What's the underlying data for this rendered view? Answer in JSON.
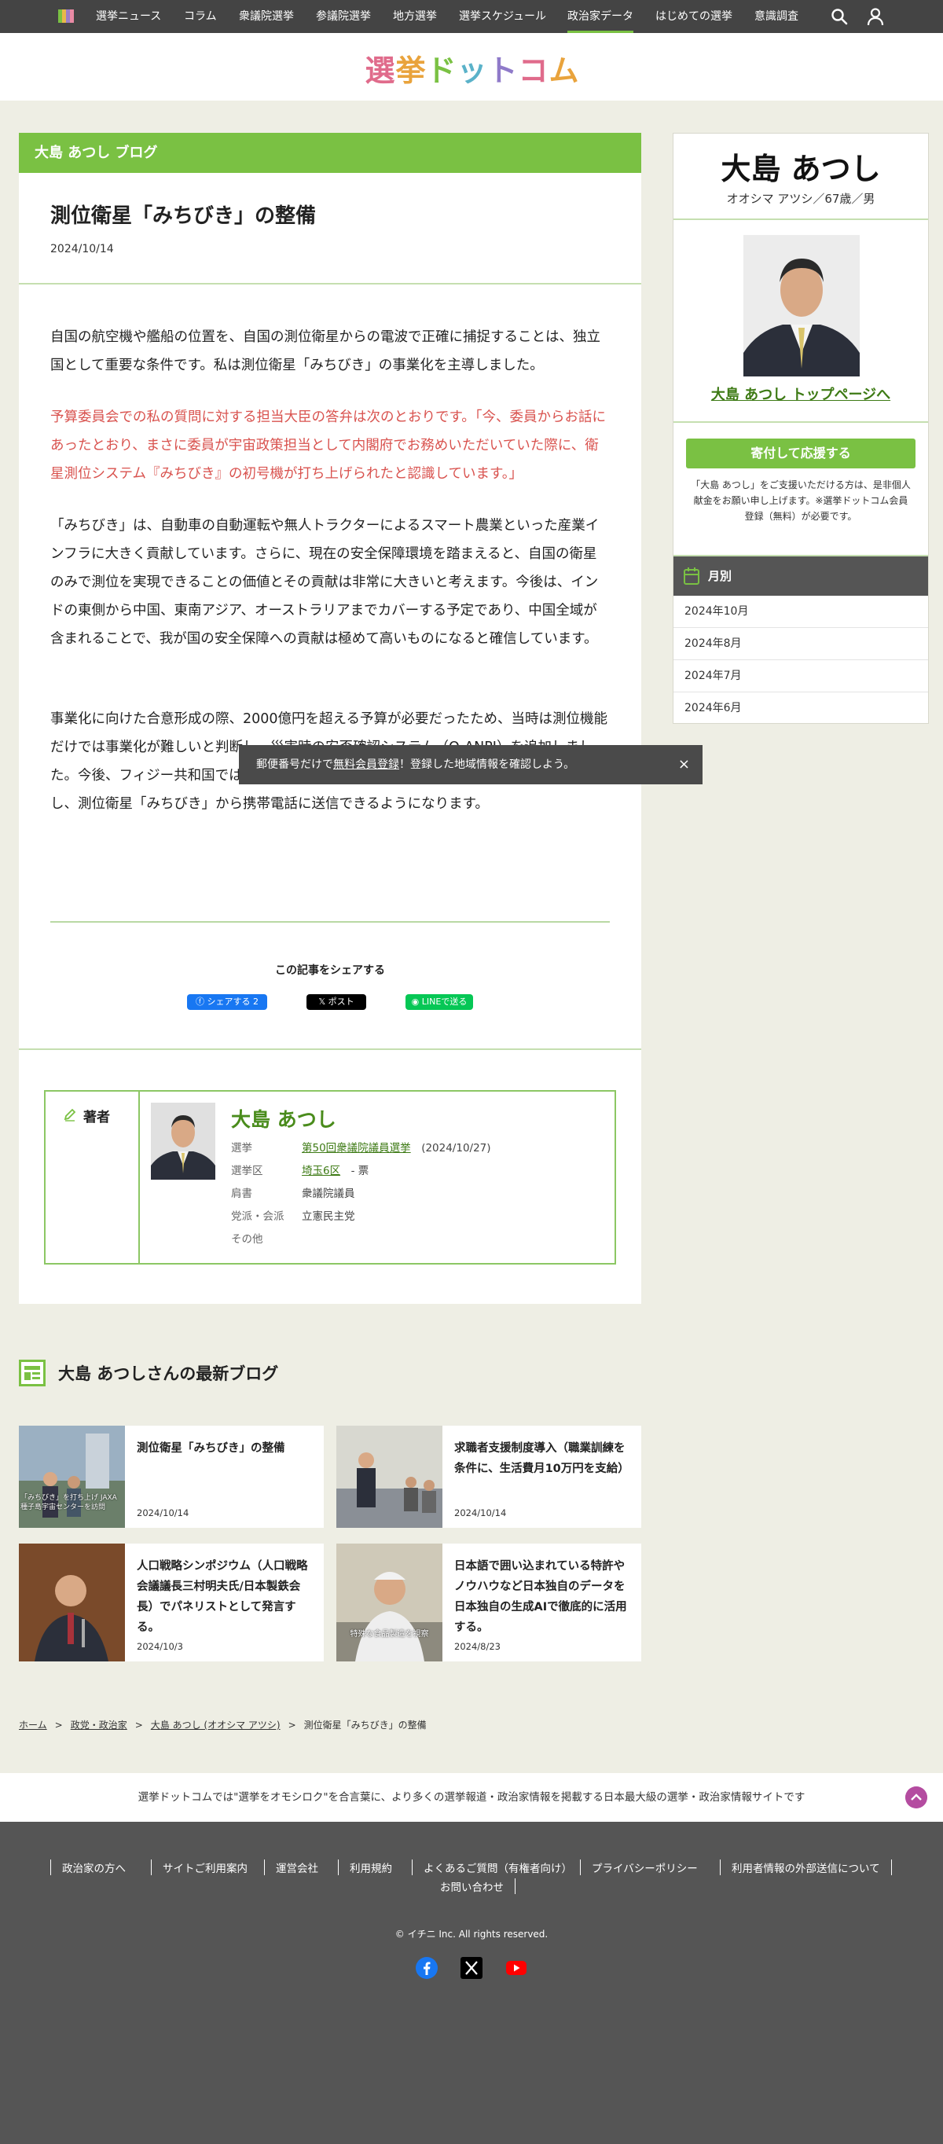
{
  "topnav": {
    "items": [
      "選挙ニュース",
      "コラム",
      "衆議院選挙",
      "参議院選挙",
      "地方選挙",
      "選挙スケジュール",
      "政治家データ",
      "はじめての選挙",
      "意識調査"
    ],
    "active_index": 6,
    "icons": [
      "search-icon",
      "user-icon"
    ]
  },
  "brand": {
    "logo_text": "選挙ドットコム"
  },
  "article": {
    "blog_header": "大島 あつし ブログ",
    "title": "測位衛星「みちびき」の整備",
    "date": "2024/10/14",
    "paragraphs": [
      "自国の航空機や艦船の位置を、自国の測位衛星からの電波で正確に捕捉することは、独立国として重要な条件です。私は測位衛星「みちびき」の事業化を主導しました。",
      "予算委員会での私の質問に対する担当大臣の答弁は次のとおりです。「今、委員からお話にあったとおり、まさに委員が宇宙政策担当として内閣府でお務めいただいていた際に、衛星測位システム『みちびき』の初号機が打ち上げられたと認識しています。」",
      "「みちびき」は、自動車の自動運転や無人トラクターによるスマート農業といった産業インフラに大きく貢献しています。さらに、現在の安全保障環境を踏まえると、自国の衛星のみで測位を実現できることの価値とその貢献は非常に大きいと考えます。今後は、インドの東側から中国、東南アジア、オーストラリアまでカバーする予定であり、中国全域が含まれることで、我が国の安全保障への貢献は極めて高いものになると確信しています。",
      "事業化に向けた合意形成の際、2000億円を超える予算が必要だったため、当時は測位機能だけでは事業化が難しいと判断し、災害時の安否確認システム（Q-ANPI）を追加しました。今後、フィジー共和国では、この「みちびき」の災害危機管理通報サービスを活用し、測位衛星「みちびき」から携帯電話に送信できるようになります。"
    ],
    "share_title": "この記事をシェアする",
    "share_buttons": {
      "facebook": "シェアする 2",
      "x": "ポスト",
      "line": "LINEで送る"
    }
  },
  "author": {
    "label": "著者",
    "name": "大島 あつし",
    "rows": [
      {
        "key": "選挙",
        "value": "第50回衆議院議員選挙",
        "extra": "(2024/10/27)"
      },
      {
        "key": "選挙区",
        "value": "埼玉6区",
        "extra": "- 票"
      },
      {
        "key": "肩書",
        "value": "衆議院議員",
        "extra": ""
      },
      {
        "key": "党派・会派",
        "value": "立憲民主党",
        "extra": ""
      },
      {
        "key": "その他",
        "value": "",
        "extra": ""
      }
    ]
  },
  "sidebar": {
    "name": "大島 あつし",
    "kana": "オオシマ アツシ／67歳／男",
    "top_link": "大島 あつし トップページへ",
    "donate_button": "寄付して応援する",
    "donate_note": "「大島 あつし」をご支援いただける方は、是非個人献金をお願い申し上げます。※選挙ドットコム会員登録（無料）が必要です。",
    "monthly_header": "月別",
    "months": [
      "2024年10月",
      "2024年8月",
      "2024年7月",
      "2024年6月"
    ]
  },
  "toast": {
    "before": "郵便番号だけで",
    "link": "無料会員登録",
    "after": "！登録した地域情報を確認しよう。",
    "close": "×"
  },
  "latest": {
    "title": "大島 あつしさんの最新ブログ",
    "cards": [
      {
        "title": "測位衛星「みちびき」の整備",
        "date": "2024/10/14"
      },
      {
        "title": "求職者支援制度導入（職業訓練を条件に、生活費月10万円を支給）",
        "date": "2024/10/14"
      },
      {
        "title": "人口戦略シンポジウム（人口戦略会議議長三村明夫氏/日本製鉄会長）でパネリストとして発言する。",
        "date": "2024/10/3"
      },
      {
        "title": "日本語で囲い込まれている特許やノウハウなど日本独自のデータを日本独自の生成AIで徹底的に活用する。",
        "date": "2024/8/23"
      }
    ],
    "thumb_captions": [
      "「みちびき」を打ち上げ JAXA種子島宇宙センターを訪問",
      "",
      "",
      "特殊な食品製造を視察"
    ]
  },
  "breadcrumbs": [
    "ホーム",
    "政党・政治家",
    "大島 あつし (オオシマ アツシ)",
    "測位衛星「みちびき」の整備"
  ],
  "tagline": "選挙ドットコムでは\"選挙をオモシロク\"を合言葉に、より多くの選挙報道・政治家情報を掲載する日本最大級の選挙・政治家情報サイトです",
  "footer": {
    "links": [
      "政治家の方へ",
      "サイトご利用案内",
      "運営会社",
      "利用規約",
      "よくあるご質問（有権者向け）",
      "プライバシーポリシー",
      "利用者情報の外部送信について",
      "お問い合わせ"
    ],
    "copyright": "© イチニ Inc. All rights reserved.",
    "social": [
      "facebook-icon",
      "x-icon",
      "youtube-icon"
    ]
  },
  "colors": {
    "accent": "#7ac143",
    "nav": "#444444",
    "footer": "#555555",
    "red_text": "#d9534f",
    "link_green": "#3d7a14"
  }
}
